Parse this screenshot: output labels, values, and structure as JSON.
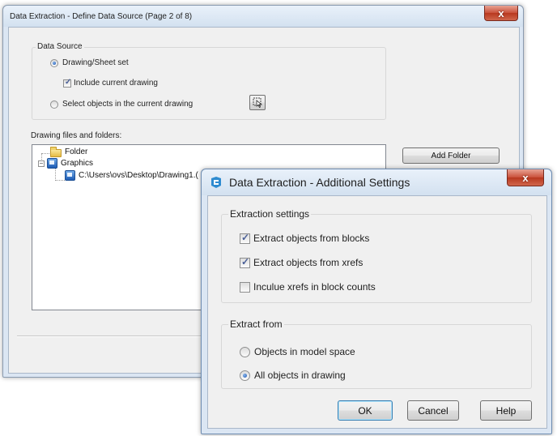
{
  "main_dialog": {
    "title": "Data Extraction - Define Data Source (Page 2 of 8)",
    "close_glyph": "x",
    "data_source": {
      "label": "Data Source",
      "drawing_sheet_set": "Drawing/Sheet set",
      "include_current_drawing": "Include current drawing",
      "select_objects": "Select objects in the current drawing"
    },
    "files_label": "Drawing files and folders:",
    "tree": {
      "folder": "Folder",
      "graphics": "Graphics",
      "drawing_path": "C:\\Users\\ovs\\Desktop\\Drawing1.("
    },
    "add_folder_label": "Add Folder"
  },
  "settings_dialog": {
    "title": "Data Extraction - Additional Settings",
    "close_glyph": "x",
    "extraction_settings": {
      "label": "Extraction settings",
      "from_blocks": "Extract objects from blocks",
      "from_xrefs": "Extract objects from xrefs",
      "xrefs_in_counts": "Inculue xrefs in block counts"
    },
    "extract_from": {
      "label": "Extract from",
      "model_space": "Objects in model space",
      "all_objects": "All objects in drawing"
    },
    "ok_label": "OK",
    "cancel_label": "Cancel",
    "help_label": "Help"
  },
  "state": {
    "drawing_sheet_set_selected": true,
    "include_current_checked": true,
    "from_blocks_checked": true,
    "from_xrefs_checked": true,
    "xrefs_in_counts_checked": false,
    "all_objects_selected": true
  },
  "icons": {
    "checkmark": "✓",
    "tree_collapse": "−",
    "select_objects": "pick-objects-icon"
  }
}
